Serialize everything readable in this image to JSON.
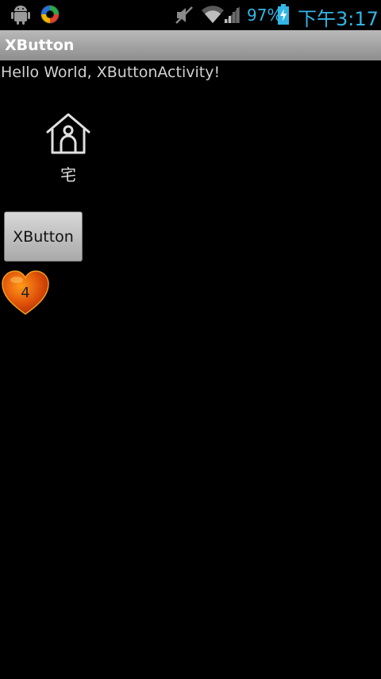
{
  "status_bar": {
    "battery_percent": "97%",
    "time": "下午3:17",
    "icons": [
      "android-debug-icon",
      "sync-icon",
      "mute-icon",
      "wifi-icon",
      "signal-icon",
      "battery-charging-icon"
    ],
    "accent_color": "#33b5e5"
  },
  "app": {
    "title": "XButton"
  },
  "main": {
    "hello_text": "Hello World, XButtonActivity!",
    "home_widget": {
      "icon": "home-icon",
      "label": "宅"
    },
    "xbutton_label": "XButton",
    "heart_badge": {
      "icon": "heart-icon",
      "count": "4",
      "color": "#d94a08"
    }
  }
}
